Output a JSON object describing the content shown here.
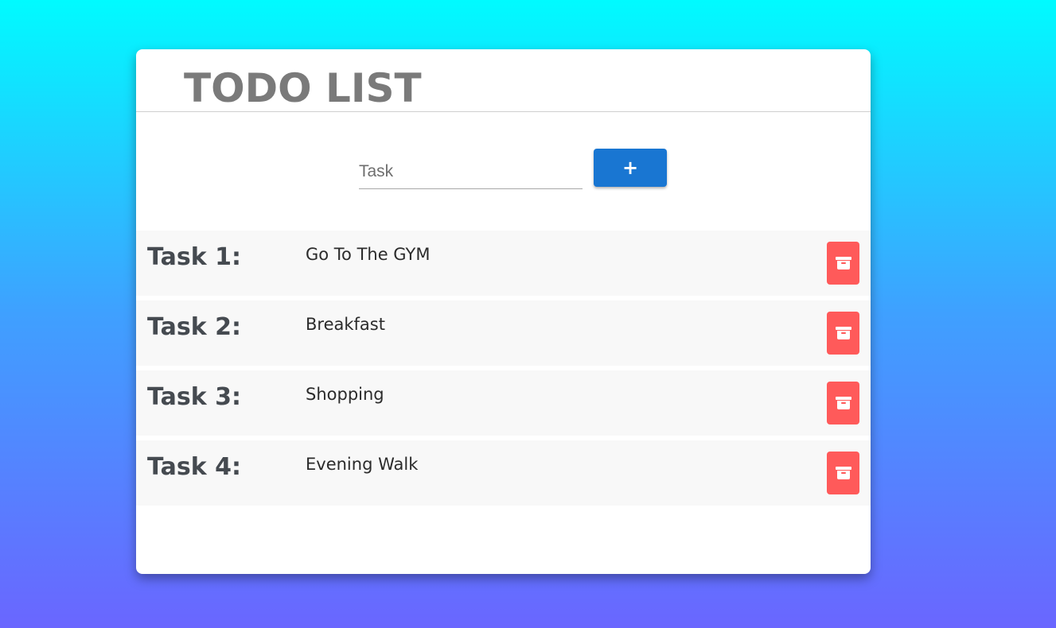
{
  "header": {
    "title": "TODO LIST"
  },
  "add_form": {
    "input_placeholder": "Task",
    "input_value": "",
    "add_label": "+"
  },
  "tasks": [
    {
      "label": "Task 1:",
      "text": "Go To The GYM"
    },
    {
      "label": "Task 2:",
      "text": "Breakfast"
    },
    {
      "label": "Task 3:",
      "text": "Shopping"
    },
    {
      "label": "Task 4:",
      "text": "Evening Walk"
    }
  ],
  "icons": {
    "delete": "archive-icon"
  },
  "colors": {
    "accent": "#1976d2",
    "delete": "#ff5a5a",
    "title": "#7a7a7a",
    "background_top": "#00fbff",
    "background_bottom": "#6a66ff"
  }
}
